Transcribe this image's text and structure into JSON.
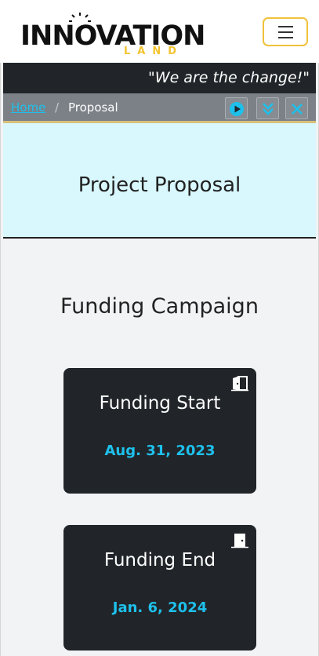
{
  "brand": {
    "logo_word": "INNOVATION",
    "logo_sub": "LAND"
  },
  "navbar": {
    "menu_button": "menu-toggler"
  },
  "tagline": "\"We are the change!\"",
  "breadcrumb": {
    "home": "Home",
    "separator": "/",
    "current": "Proposal"
  },
  "toolbar": {
    "play_icon": "play-icon",
    "expand_icon": "double-chevron-down-icon",
    "close_icon": "close-icon"
  },
  "hero": {
    "title": "Project Proposal"
  },
  "section": {
    "title": "Funding Campaign"
  },
  "cards": [
    {
      "title": "Funding Start",
      "date": "Aug. 31, 2023",
      "icon": "door-open-icon"
    },
    {
      "title": "Funding End",
      "date": "Jan. 6, 2024",
      "icon": "door-closed-icon"
    }
  ],
  "colors": {
    "accent": "#1ec0ec",
    "dark": "#212529",
    "logo_gold": "#f4c430",
    "hero_bg": "#d8f8fd"
  }
}
